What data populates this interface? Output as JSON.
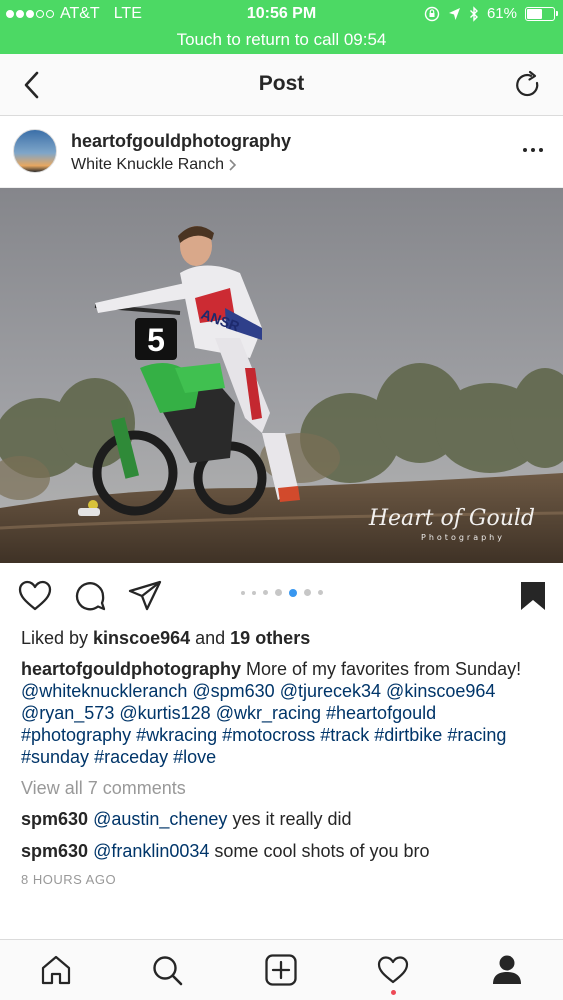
{
  "status_bar": {
    "carrier": "AT&T",
    "network": "LTE",
    "time": "10:56 PM",
    "battery_percent": "61%",
    "battery_level": 0.61,
    "signal_bars": 3,
    "signal_total": 5
  },
  "call_banner": {
    "text": "Touch to return to call 09:54"
  },
  "nav": {
    "title": "Post"
  },
  "post": {
    "username": "heartofgouldphotography",
    "location": "White Knuckle Ranch",
    "watermark": "Heart of Gould",
    "watermark_sub": "Photography",
    "bib_number": "5",
    "rider_brand": "ANSR",
    "carousel": {
      "count": 7,
      "active_index": 4
    },
    "likes": {
      "prefix": "Liked by ",
      "user": "kinscoe964",
      "middle": " and ",
      "others": "19 others"
    },
    "caption": {
      "username": "heartofgouldphotography",
      "text": "More of my favorites from Sunday!",
      "mentions": [
        "@whiteknuckleranch",
        "@spm630",
        "@tjurecek34",
        "@kinscoe964",
        "@ryan_573",
        "@kurtis128",
        "@wkr_racing"
      ],
      "hashtags": [
        "#heartofgould",
        "#photography",
        "#wkracing",
        "#motocross",
        "#track",
        "#dirtbike",
        "#racing",
        "#sunday",
        "#raceday",
        "#love"
      ]
    },
    "view_all_comments": "View all 7 comments",
    "comments": [
      {
        "user": "spm630",
        "mention": "@austin_cheney",
        "text": "yes it really did"
      },
      {
        "user": "spm630",
        "mention": "@franklin0034",
        "text": "some cool shots of you bro"
      }
    ],
    "timestamp": "8 HOURS AGO"
  },
  "tab_bar": {
    "items": [
      "home-icon",
      "search-icon",
      "add-post-icon",
      "activity-heart-icon",
      "profile-icon"
    ],
    "has_activity_notification": true
  },
  "colors": {
    "status_green": "#4cd964",
    "link_blue": "#003569",
    "carousel_active": "#3897f0",
    "notification_red": "#ed4956"
  }
}
